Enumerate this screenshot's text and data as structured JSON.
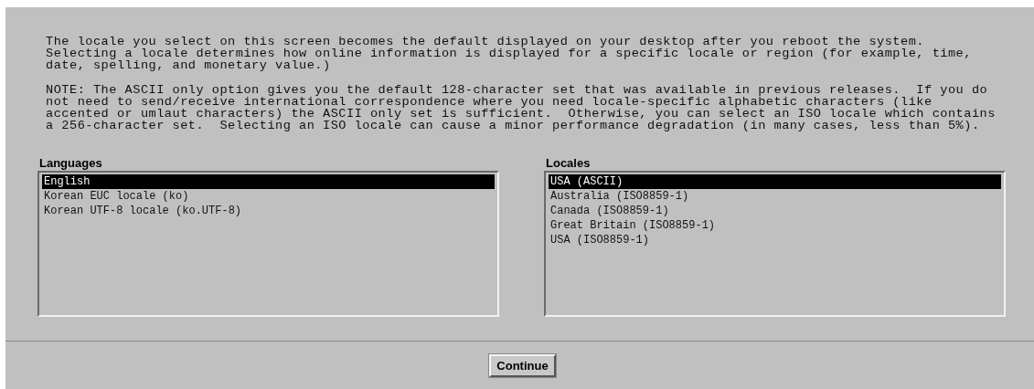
{
  "intro": [
    "The locale you select on this screen becomes the default displayed on your desktop after you reboot the system.\nSelecting a locale determines how online information is displayed for a specific locale or region (for example, time,\ndate, spelling, and monetary value.)",
    "NOTE: The ASCII only option gives you the default 128-character set that was available in previous releases.  If you do\nnot need to send/receive international correspondence where you need locale-specific alphabetic characters (like\naccented or umlaut characters) the ASCII only set is sufficient.  Otherwise, you can select an ISO locale which contains\na 256-character set.  Selecting an ISO locale can cause a minor performance degradation (in many cases, less than 5%)."
  ],
  "lists": [
    {
      "label": "Languages",
      "items": [
        {
          "label": "English",
          "selected": true
        },
        {
          "label": "Korean EUC locale (ko)",
          "selected": false
        },
        {
          "label": "Korean UTF-8 locale (ko.UTF-8)",
          "selected": false
        }
      ]
    },
    {
      "label": "Locales",
      "items": [
        {
          "label": "USA (ASCII)",
          "selected": true
        },
        {
          "label": "Australia (ISO8859-1)",
          "selected": false
        },
        {
          "label": "Canada (ISO8859-1)",
          "selected": false
        },
        {
          "label": "Great Britain (ISO8859-1)",
          "selected": false
        },
        {
          "label": "USA (ISO8859-1)",
          "selected": false
        }
      ]
    }
  ],
  "buttons": [
    "Continue"
  ]
}
